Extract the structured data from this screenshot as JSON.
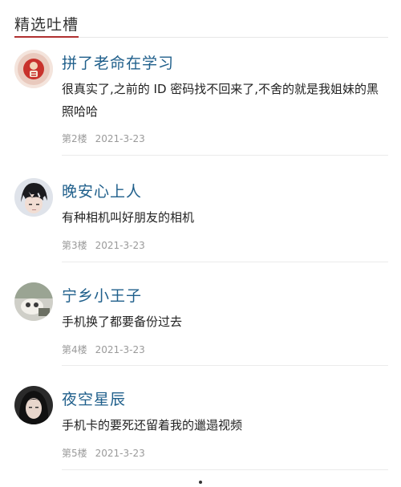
{
  "section": {
    "title": "精选吐槽"
  },
  "comments": [
    {
      "username": "拼了老命在学习",
      "content": "很真实了,之前的 ID 密码找不回来了,不舍的就是我姐妹的黑照哈哈",
      "floor": "第2楼",
      "date": "2021-3-23",
      "avatar_icon": "red-cartoon-avatar"
    },
    {
      "username": "晚安心上人",
      "content": "有种相机叫好朋友的相机",
      "floor": "第3楼",
      "date": "2021-3-23",
      "avatar_icon": "anime-boy-avatar"
    },
    {
      "username": "宁乡小王子",
      "content": "手机换了都要备份过去",
      "floor": "第4楼",
      "date": "2021-3-23",
      "avatar_icon": "photo-avatar"
    },
    {
      "username": "夜空星辰",
      "content": "手机卡的要死还留着我的邋遢视频",
      "floor": "第5楼",
      "date": "2021-3-23",
      "avatar_icon": "dark-hair-girl-avatar"
    }
  ],
  "colors": {
    "username": "#1f5f8b",
    "accent": "#b03030",
    "meta": "#9a9a9a"
  }
}
